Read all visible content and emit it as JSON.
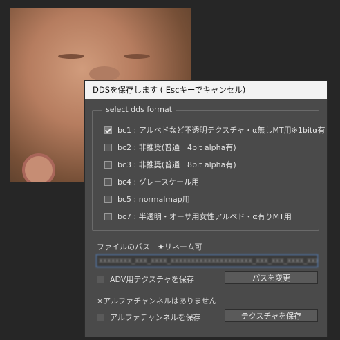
{
  "dialog": {
    "title": "DDSを保存します ( Escキーでキャンセル)",
    "format_group": {
      "legend": "select dds format",
      "options": [
        {
          "label": "bc1 : アルベドなど不透明テクスチャ・α無しMT用※1bitα有",
          "checked": true
        },
        {
          "label": "bc2 : 非推奨(普通　4bit alpha有)",
          "checked": false
        },
        {
          "label": "bc3 : 非推奨(普通　8bit alpha有)",
          "checked": false
        },
        {
          "label": "bc4 : グレースケール用",
          "checked": false
        },
        {
          "label": "bc5 : normalmap用",
          "checked": false
        },
        {
          "label": "bc7 : 半透明・オーサ用女性アルベド・α有りMT用",
          "checked": false
        }
      ]
    },
    "file_path": {
      "label": "ファイルのパス　★リネーム可",
      "value": "xxxxxxxx_xxx_xxxx_xxxxxxxxxxxxxxxxxxxx_xxx_xxx_xxxx_xxxx_x"
    },
    "adv_save": {
      "label": "ADV用テクスチャを保存",
      "checked": false
    },
    "change_path_button": "パスを変更",
    "no_alpha_note": "×アルファチャンネルはありません",
    "alpha_save": {
      "label": "アルファチャンネルを保存",
      "checked": false
    },
    "save_texture_button": "テクスチャを保存"
  },
  "colors": {
    "dialog_bg": "#4a4a4a",
    "titlebar_bg": "#f3f3f3",
    "input_focus_border": "#5a8ed6"
  }
}
